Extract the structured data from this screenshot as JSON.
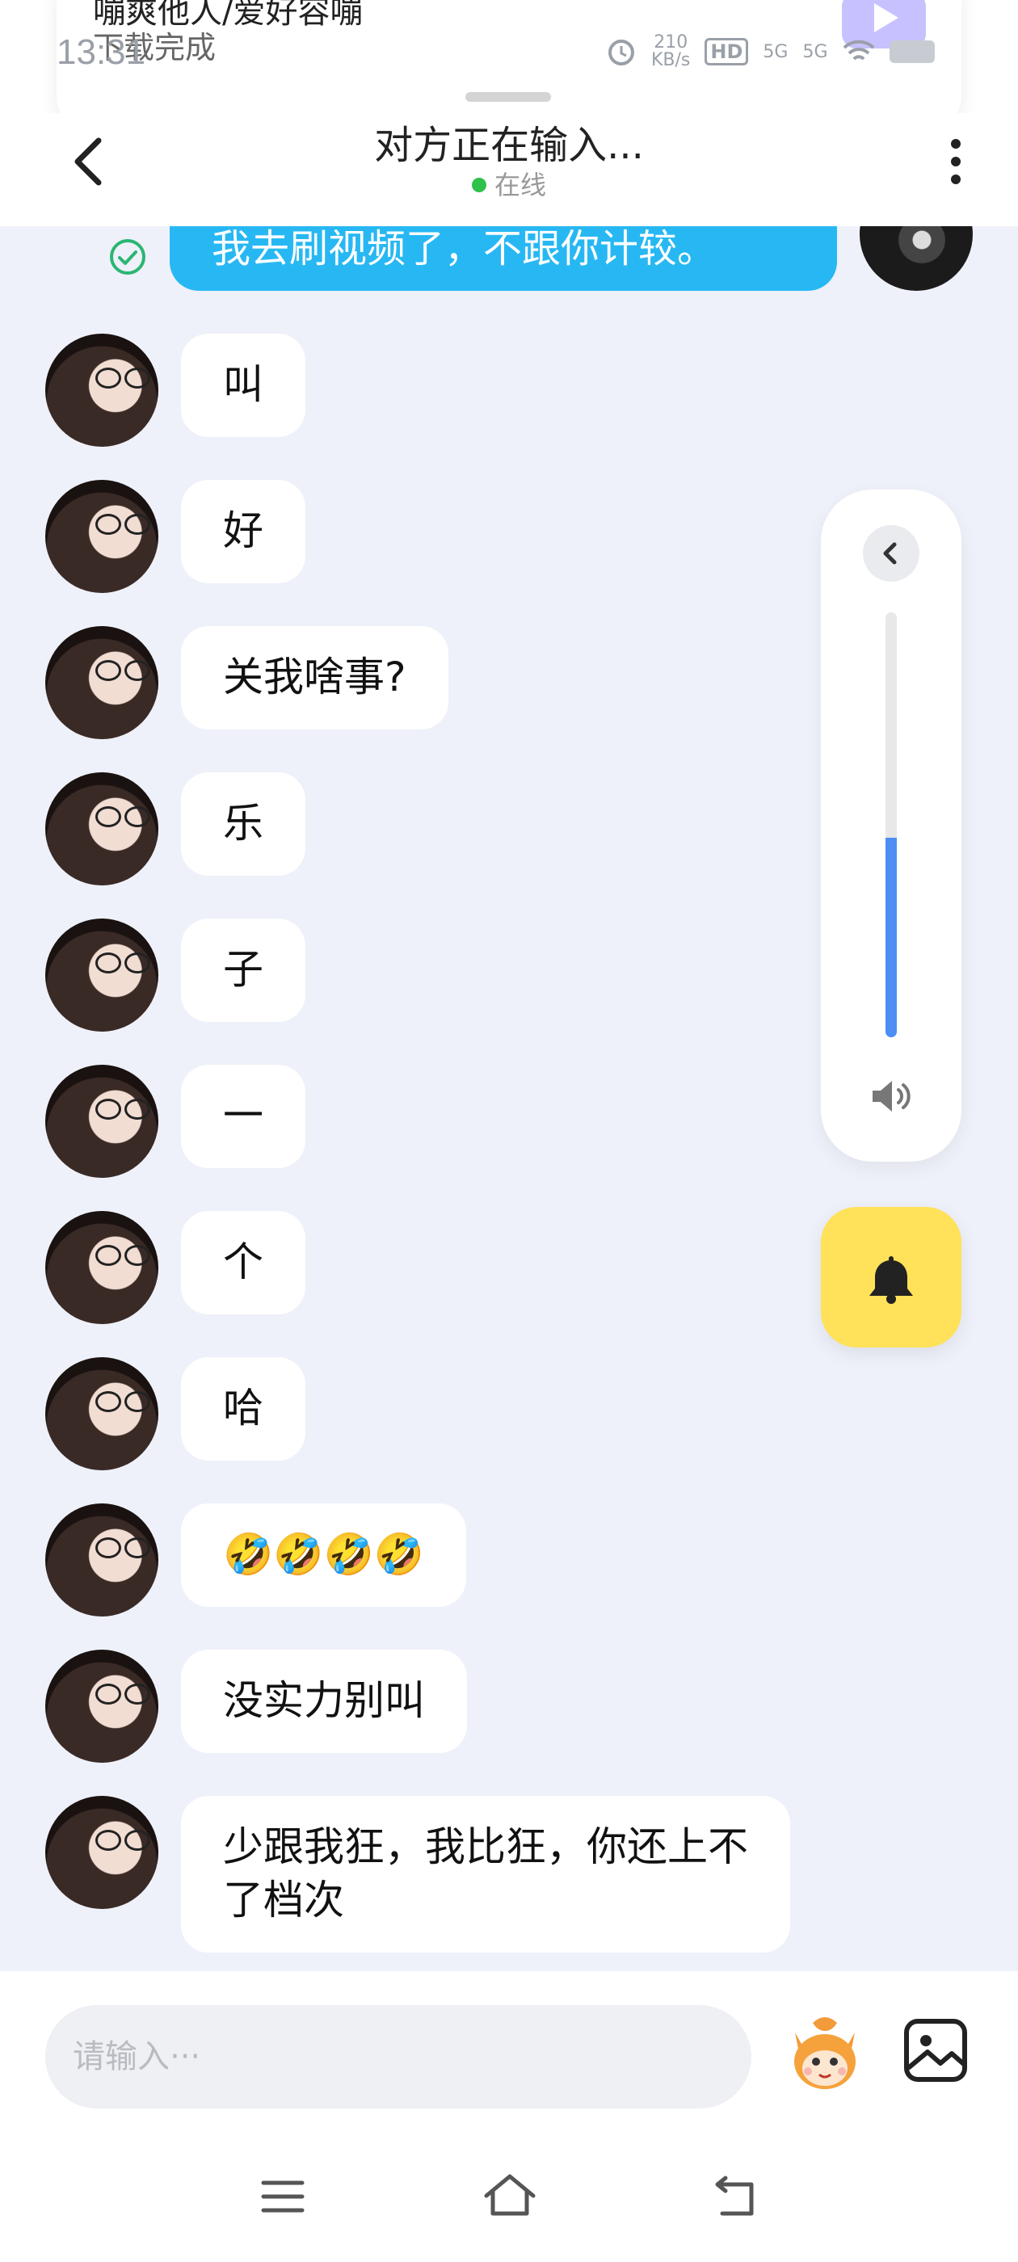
{
  "status_bar": {
    "time": "13:31",
    "notification_title": "嘣爽他人/爱好容嘣",
    "notification_subtitle": "下载完成",
    "net_speed_value": "210",
    "net_speed_unit": "KB/s",
    "hd_label": "HD",
    "sim_labels": [
      "5G",
      "5G"
    ]
  },
  "header": {
    "title": "对方正在输入...",
    "status": "在线",
    "online_color": "#2ec24a"
  },
  "chat": {
    "sent_message": "我去刷视频了，不跟你计较。",
    "received_messages": [
      {
        "text": "叫"
      },
      {
        "text": "好"
      },
      {
        "text": "关我啥事?"
      },
      {
        "text": "乐"
      },
      {
        "text": "子"
      },
      {
        "text": "一"
      },
      {
        "text": "个"
      },
      {
        "text": "哈"
      },
      {
        "text": "🤣🤣🤣🤣"
      },
      {
        "text": "没实力别叫"
      },
      {
        "text": "少跟我狂，我比狂，你还上不\n了档次"
      }
    ]
  },
  "volume_panel": {
    "level": 0.47,
    "accent": "#4d8ef5"
  },
  "input_bar": {
    "placeholder": "请输入···"
  },
  "colors": {
    "sent_bubble": "#27b8f3",
    "bell_button": "#ffe15a",
    "background": "#eef1f9"
  },
  "icons": [
    "back-arrow-icon",
    "more-vert-icon",
    "read-check-icon",
    "chevron-left-icon",
    "speaker-icon",
    "bell-icon",
    "mascot-icon",
    "image-icon",
    "menu-icon",
    "home-icon",
    "back-icon"
  ]
}
